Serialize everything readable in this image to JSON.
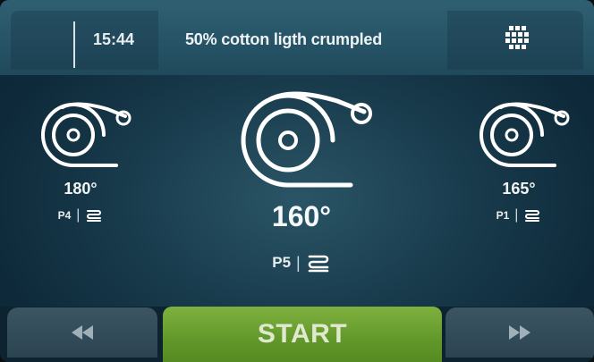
{
  "header": {
    "time": "15:44",
    "program_name": "50% cotton ligth crumpled",
    "menu_icon": "grid-menu-icon"
  },
  "profiles": {
    "left": {
      "temperature": "180°",
      "program": "P4",
      "icon": "ironer-roll-icon",
      "mode_icon": "folding-mode-icon"
    },
    "center": {
      "temperature": "160°",
      "program": "P5",
      "icon": "ironer-roll-icon",
      "mode_icon": "folding-mode-icon"
    },
    "right": {
      "temperature": "165°",
      "program": "P1",
      "icon": "ironer-roll-icon",
      "mode_icon": "folding-mode-icon"
    }
  },
  "footer": {
    "start_label": "START",
    "prev_icon": "rewind-icon",
    "next_icon": "fast-forward-icon"
  },
  "colors": {
    "accent_green": "#6aa32f",
    "panel_teal": "#1f4a5c",
    "button_gray": "#354d5b"
  }
}
